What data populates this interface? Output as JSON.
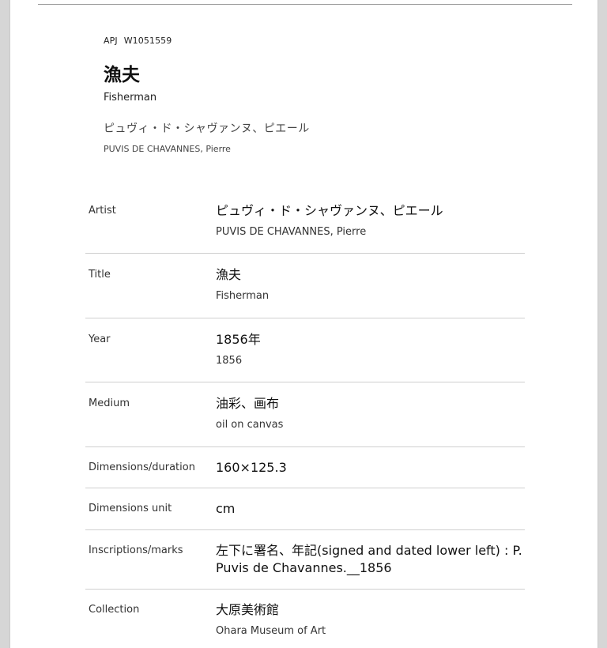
{
  "header": {
    "source": "APJ",
    "id": "W1051559",
    "title_ja": "漁夫",
    "title_en": "Fisherman",
    "artist_ja": "ピュヴィ・ド・シャヴァンヌ、ピエール",
    "artist_en": "PUVIS DE CHAVANNES, Pierre"
  },
  "details": {
    "artist": {
      "label": "Artist",
      "main": "ピュヴィ・ド・シャヴァンヌ、ピエール",
      "sub": "PUVIS DE CHAVANNES, Pierre"
    },
    "title": {
      "label": "Title",
      "main": "漁夫",
      "sub": "Fisherman"
    },
    "year": {
      "label": "Year",
      "main": "1856年",
      "sub": "1856"
    },
    "medium": {
      "label": "Medium",
      "main": "油彩、画布",
      "sub": "oil on canvas"
    },
    "dimensions": {
      "label": "Dimensions/duration",
      "main": "160×125.3"
    },
    "unit": {
      "label": "Dimensions unit",
      "main": "cm"
    },
    "inscriptions": {
      "label": "Inscriptions/marks",
      "main": "左下に署名、年記(signed and dated lower left) : P. Puvis de Chavannes.__1856"
    },
    "collection": {
      "label": "Collection",
      "main": "大原美術館",
      "sub": "Ohara Museum of Art"
    }
  }
}
